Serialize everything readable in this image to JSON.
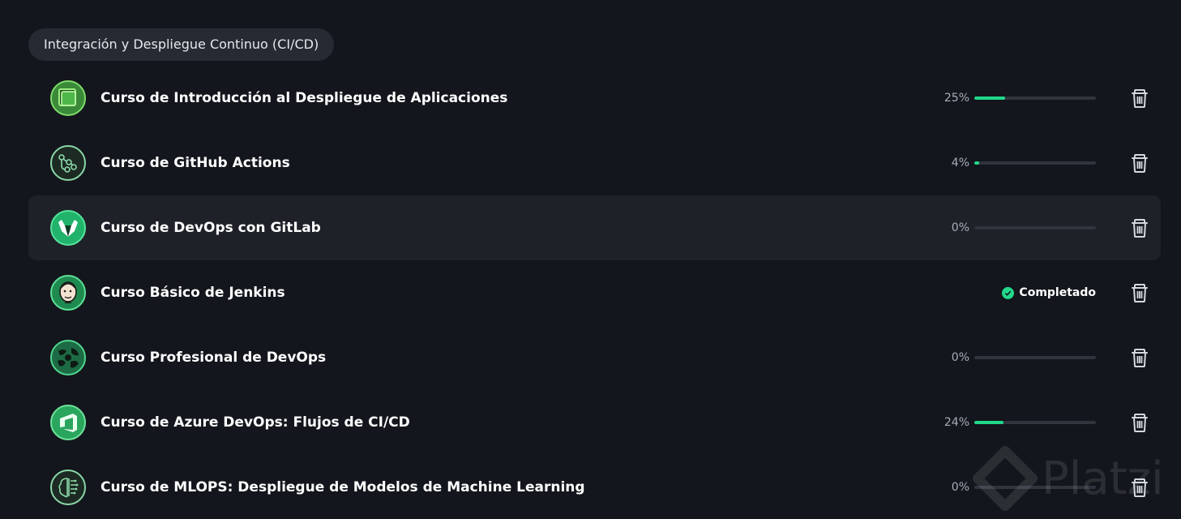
{
  "section": {
    "title": "Integración y Despliegue Continuo (CI/CD)"
  },
  "courses": [
    {
      "title": "Curso de Introducción al Despliegue de Aplicaciones",
      "status": "progress",
      "percent_label": "25%",
      "progress": 0.25,
      "icon": "deployment-layers-icon"
    },
    {
      "title": "Curso de GitHub Actions",
      "status": "progress",
      "percent_label": "4%",
      "progress": 0.04,
      "icon": "github-actions-workflow-icon"
    },
    {
      "title": "Curso de DevOps con GitLab",
      "status": "progress",
      "percent_label": "0%",
      "progress": 0,
      "icon": "gitlab-fox-icon",
      "highlighted": true
    },
    {
      "title": "Curso Básico de Jenkins",
      "status": "completed",
      "completed_label": "Completado",
      "icon": "jenkins-butler-icon"
    },
    {
      "title": "Curso Profesional de DevOps",
      "status": "progress",
      "percent_label": "0%",
      "progress": 0,
      "icon": "devops-globe-icon"
    },
    {
      "title": "Curso de Azure DevOps: Flujos de CI/CD",
      "status": "progress",
      "percent_label": "24%",
      "progress": 0.24,
      "icon": "azure-devops-icon"
    },
    {
      "title": "Curso de MLOPS: Despliegue de Modelos de Machine Learning",
      "status": "progress",
      "percent_label": "0%",
      "progress": 0,
      "icon": "machine-learning-brain-icon"
    }
  ],
  "watermark": {
    "text": "Platzi",
    "icon": "platzi-logo-icon"
  },
  "colors": {
    "background": "#13161c",
    "accent": "#21d88a",
    "track": "#2f343d",
    "row_highlight": "#1e2128",
    "pill": "#262a33"
  }
}
